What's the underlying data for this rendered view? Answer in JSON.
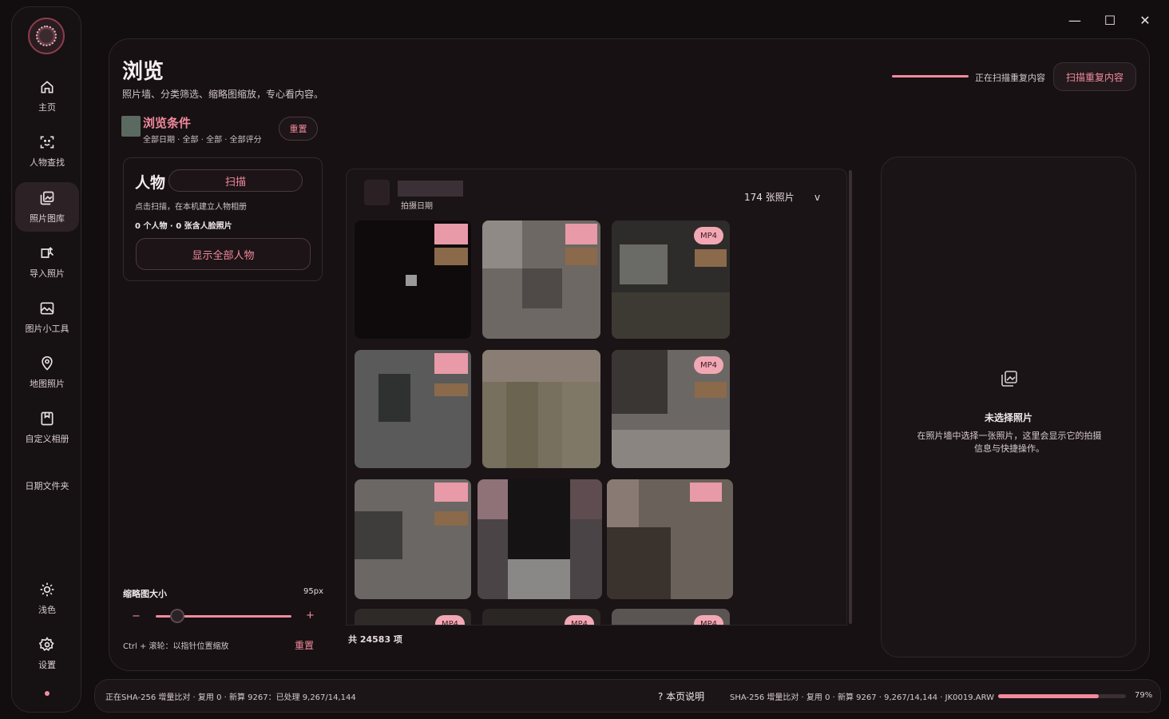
{
  "window": {
    "minimize_glyph": "—",
    "maximize_glyph": "☐",
    "close_glyph": "✕"
  },
  "sidebar": {
    "items": [
      {
        "label": "主页",
        "icon": "home-icon"
      },
      {
        "label": "人物查找",
        "icon": "face-scan-icon"
      },
      {
        "label": "照片图库",
        "icon": "gallery-icon",
        "active": true
      },
      {
        "label": "导入照片",
        "icon": "import-icon"
      },
      {
        "label": "图片小工具",
        "icon": "image-tool-icon"
      },
      {
        "label": "地图照片",
        "icon": "map-pin-icon"
      },
      {
        "label": "自定义相册",
        "icon": "album-icon"
      },
      {
        "label": "日期文件夹",
        "icon": "none"
      }
    ],
    "bottom": [
      {
        "label": "浅色",
        "icon": "sun-icon"
      },
      {
        "label": "设置",
        "icon": "gear-icon"
      }
    ]
  },
  "header": {
    "title": "浏览",
    "subtitle": "照片墙、分类筛选、缩略图缩放，专心看内容。",
    "scan_status": "正在扫描重复内容",
    "scan_button": "扫描重复内容"
  },
  "filter": {
    "title": "浏览条件",
    "description": "全部日期 · 全部 · 全部 · 全部评分",
    "reset": "重置"
  },
  "people": {
    "title": "人物",
    "scan_button": "扫描",
    "hint": "点击扫描，在本机建立人物相册",
    "count": "0 个人物 · 0 张含人脸照片",
    "show_all": "显示全部人物"
  },
  "thumbnail": {
    "label": "缩略图大小",
    "value": "95px",
    "minus": "−",
    "plus": "+",
    "level": 0.16,
    "hint": "Ctrl + 滚轮：以指针位置缩放",
    "reset": "重置"
  },
  "wall": {
    "date_label": "拍摄日期",
    "count_number": "174",
    "count_unit": "张照片",
    "chevron": "v",
    "badge": "MP4",
    "total": "共 24583 项"
  },
  "detail": {
    "title": "未选择照片",
    "text": "在照片墙中选择一张照片，这里会显示它的拍摄信息与快捷操作。",
    "icon": "gallery-icon"
  },
  "status": {
    "left": "正在SHA-256 增量比对 · 复用 0 · 新算 9267：已处理 9,267/14,144",
    "help": "? 本页说明",
    "right": "SHA-256 增量比对 · 复用 0 · 新算 9267 · 9,267/14,144 · JK0019.ARW",
    "progress": 0.79,
    "progress_text": "79%"
  },
  "colors": {
    "accent": "#f08a9d",
    "background": "#120d0f",
    "panel": "#171113"
  }
}
